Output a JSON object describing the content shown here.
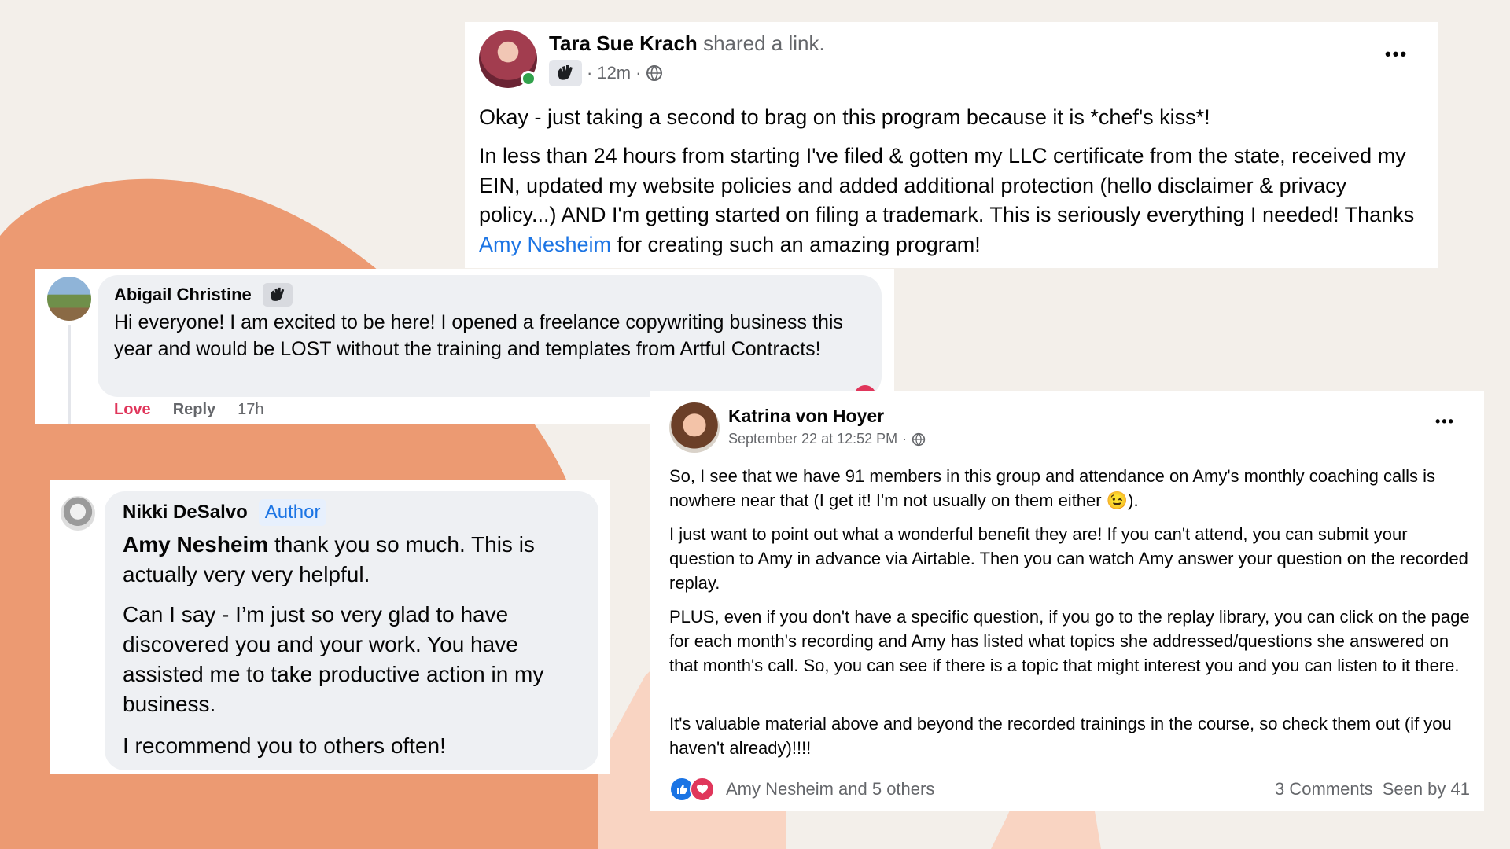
{
  "post1": {
    "author": "Tara Sue Krach",
    "action": "shared a link.",
    "time": "12m",
    "separator": "·",
    "line1": "Okay - just taking a second to brag on this program because it is *chef's kiss*!",
    "body_start": "In less than 24 hours from starting I've filed & gotten my LLC certificate from the state, received my EIN, updated my website policies and added additional protection (hello disclaimer & privacy policy...) AND I'm getting started on filing a trademark. This is seriously everything I needed! Thanks ",
    "mention": "Amy Nesheim",
    "body_end": " for creating such an amazing program!",
    "more": "•••"
  },
  "comment1": {
    "author": "Abigail Christine",
    "text": "Hi everyone! I am excited to be here! I opened a freelance copywriting business this year and would be LOST without the training and templates from Artful Contracts!",
    "love": "Love",
    "reply": "Reply",
    "time": "17h"
  },
  "comment2": {
    "author": "Nikki DeSalvo",
    "badge": "Author",
    "mention": "Amy Nesheim",
    "p1_rest": " thank you so much. This is actually very very helpful.",
    "p2": "Can I say - I’m just so very glad to have discovered you and your work. You have assisted me to take productive action in my business.",
    "p3": "I recommend you to others often!"
  },
  "post2": {
    "author": "Katrina von Hoyer",
    "date": "September 22 at 12:52 PM",
    "separator": "·",
    "more": "•••",
    "p1": "So, I see that we have 91 members in this group and attendance on Amy's monthly coaching calls is nowhere near that (I get it! I'm not usually on them either ",
    "p1_emoji": "😉",
    "p1_end": ").",
    "p2": "I just want to point out what a wonderful benefit they are!  If you can't attend, you can submit your question to Amy in advance via Airtable.  Then you can watch Amy answer your question on the recorded replay.",
    "p3": "PLUS, even if you don't have a specific question, if you go to the replay library, you can click on the page for each month's recording and Amy has listed what topics she addressed/questions she answered on that month's call.  So, you can see if there is a topic that might interest you and you can listen to it there.",
    "p4": "It's valuable material above and beyond the recorded trainings in the course, so check them out (if you haven't already)!!!!",
    "reactions": "Amy Nesheim and 5 others",
    "comments": "3 Comments",
    "seen": "Seen by 41"
  },
  "colors": {
    "background": "#f3efea",
    "blob_orange": "#ec9a72",
    "blob_peach": "#f9d4c2",
    "link": "#1b74e4",
    "love": "#e0365b",
    "online": "#31a24c"
  },
  "icons": [
    "wave-badge-icon",
    "globe-icon",
    "like-reaction-icon",
    "love-reaction-icon",
    "more-options-icon"
  ]
}
